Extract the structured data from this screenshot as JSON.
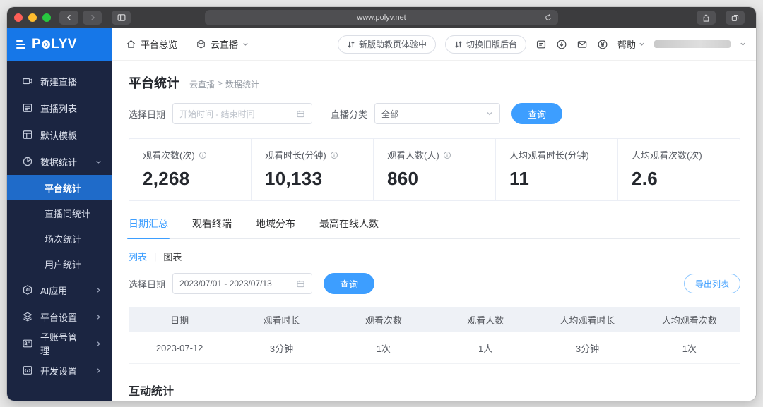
{
  "browser": {
    "url": "www.polyv.net"
  },
  "logo": {
    "text": "POLYV"
  },
  "top_nav": {
    "items": [
      {
        "label": "平台总览",
        "icon": "home-icon"
      },
      {
        "label": "云直播",
        "icon": "cube-icon"
      }
    ],
    "pills": [
      {
        "label": "新版助教页体验中",
        "icon": "swap-arrows-icon"
      },
      {
        "label": "切换旧版后台",
        "icon": "swap-arrows-icon"
      }
    ],
    "icon_buttons": [
      "document-icon",
      "download-icon",
      "mail-icon",
      "currency-icon"
    ],
    "help_label": "帮助"
  },
  "sidebar": {
    "items": [
      {
        "label": "新建直播",
        "icon": "camera-icon"
      },
      {
        "label": "直播列表",
        "icon": "list-icon"
      },
      {
        "label": "默认模板",
        "icon": "template-icon"
      },
      {
        "label": "数据统计",
        "icon": "pie-icon",
        "expanded": true
      },
      {
        "label": "平台统计",
        "sub": true,
        "active": true
      },
      {
        "label": "直播间统计",
        "sub": true
      },
      {
        "label": "场次统计",
        "sub": true
      },
      {
        "label": "用户统计",
        "sub": true
      },
      {
        "label": "AI应用",
        "icon": "ai-icon",
        "collapsed": true
      },
      {
        "label": "平台设置",
        "icon": "layers-icon",
        "collapsed": true
      },
      {
        "label": "子账号管理",
        "icon": "idcard-icon",
        "collapsed": true
      },
      {
        "label": "开发设置",
        "icon": "code-icon",
        "collapsed": true
      }
    ]
  },
  "page": {
    "title": "平台统计",
    "breadcrumb": {
      "parent": "云直播",
      "sep": ">",
      "current": "数据统计"
    }
  },
  "filters": {
    "date_label": "选择日期",
    "date_placeholder": "开始时间 - 结束时间",
    "category_label": "直播分类",
    "category_value": "全部",
    "query_label": "查询"
  },
  "stats": {
    "cards": [
      {
        "label": "观看次数(次)",
        "value": "2,268",
        "info": true
      },
      {
        "label": "观看时长(分钟)",
        "value": "10,133",
        "info": true
      },
      {
        "label": "观看人数(人)",
        "value": "860",
        "info": true
      },
      {
        "label": "人均观看时长(分钟)",
        "value": "11"
      },
      {
        "label": "人均观看次数(次)",
        "value": "2.6"
      }
    ]
  },
  "tabs": [
    {
      "label": "日期汇总",
      "active": true
    },
    {
      "label": "观看终端"
    },
    {
      "label": "地域分布"
    },
    {
      "label": "最高在线人数"
    }
  ],
  "view_toggle": {
    "list_label": "列表",
    "divider": "|",
    "chart_label": "图表"
  },
  "date_query": {
    "label": "选择日期",
    "value": "2023/07/01 - 2023/07/13",
    "query_label": "查询",
    "export_label": "导出列表"
  },
  "table": {
    "columns": [
      "日期",
      "观看时长",
      "观看次数",
      "观看人数",
      "人均观看时长",
      "人均观看次数"
    ],
    "rows": [
      [
        "2023-07-12",
        "3分钟",
        "1次",
        "1人",
        "3分钟",
        "1次"
      ]
    ]
  },
  "sections": {
    "interaction_title": "互动统计"
  },
  "colors": {
    "brand_blue": "#1677e8",
    "accent_blue": "#3d9eff",
    "sidebar_bg": "#1b2541",
    "active_item_bg": "#1f6bc9",
    "table_header_bg": "#eef1f6"
  }
}
